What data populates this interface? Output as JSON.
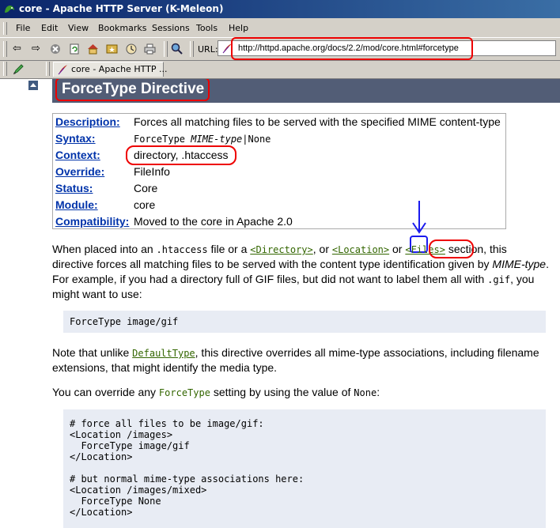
{
  "window": {
    "title": "core - Apache HTTP Server (K-Meleon)"
  },
  "menu": [
    "File",
    "Edit",
    "View",
    "Bookmarks",
    "Sessions",
    "Tools",
    "Help"
  ],
  "toolbar": {
    "url_label": "URL:",
    "url": "http://httpd.apache.org/docs/2.2/mod/core.html#forcetype"
  },
  "tab": {
    "label": "core - Apache HTTP ..."
  },
  "page": {
    "heading": "ForceType Directive",
    "rows": [
      {
        "label": "Description:",
        "value": "Forces all matching files to be served with the specified MIME content-type"
      },
      {
        "label": "Syntax:",
        "value_code": "ForceType ",
        "value_italic": "MIME-type",
        "value_tail": "|None"
      },
      {
        "label": "Context:",
        "value": "directory, .htaccess"
      },
      {
        "label": "Override:",
        "value": "FileInfo"
      },
      {
        "label": "Status:",
        "value": "Core"
      },
      {
        "label": "Module:",
        "value": "core"
      },
      {
        "label": "Compatibility:",
        "value": "Moved to the core in Apache 2.0"
      }
    ],
    "p1": {
      "a": "When placed into an ",
      "b": ".htaccess",
      "c": " file or a ",
      "d": "<Directory>",
      "e": ", or ",
      "f": "<Location>",
      "g": " or ",
      "h": "<Files>",
      "i": " section, this",
      "line2a": "directive forces all matching files to be served with the content type identification given by ",
      "line2b": "MIME-type",
      "line2c": ".",
      "line3a": "For example, if you had a directory full of GIF files, but did not want to label them all with ",
      "line3b": ".gif",
      "line3c": ", you",
      "line4": "might want to use:"
    },
    "code1": "ForceType image/gif",
    "p2": {
      "a": "Note that unlike ",
      "b": "DefaultType",
      "c": ", this directive overrides all mime-type associations, including filename",
      "line2": "extensions, that might identify the media type."
    },
    "p3": {
      "a": "You can override any ",
      "b": "ForceType",
      "c": " setting by using the value of ",
      "d": "None",
      "e": ":"
    },
    "code2": "# force all files to be image/gif:\n<Location /images>\n  ForceType image/gif\n</Location>\n\n# but normal mime-type associations here:\n<Location /images/mixed>\n  ForceType None\n</Location>"
  }
}
